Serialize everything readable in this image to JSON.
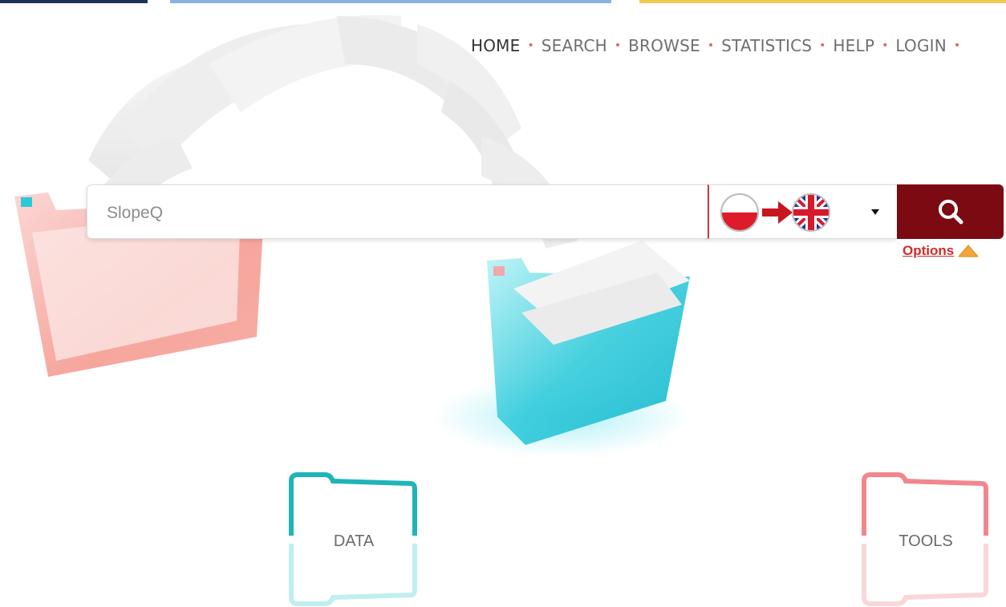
{
  "nav": {
    "items": [
      "HOME",
      "SEARCH",
      "BROWSE",
      "STATISTICS",
      "HELP",
      "LOGIN"
    ],
    "active": "HOME"
  },
  "search": {
    "placeholder": "SlopeQ",
    "value": ""
  },
  "language": {
    "from": "Polish flag",
    "to": "UK flag"
  },
  "options_label": "Options",
  "tiles": {
    "data": "DATA",
    "tools": "TOOLS"
  },
  "colors": {
    "accent": "#7c0a12",
    "teal": "#1bb6c0",
    "pink": "#f08a91",
    "link": "#d32b2b"
  }
}
